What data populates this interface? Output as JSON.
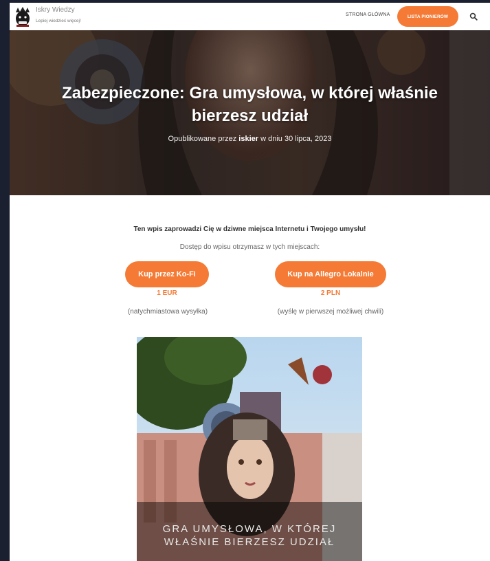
{
  "site": {
    "title": "Iskry Wiedzy",
    "tagline": "Lepiej wiedzieć więcej!"
  },
  "nav": {
    "home": "STRONA GŁÓWNA",
    "cta": "LISTA PIONIERÓW",
    "search_icon": "search-icon"
  },
  "post": {
    "title": "Zabezpieczone: Gra umysłowa, w której właśnie bierzesz udział",
    "meta_prefix": "Opublikowane przez",
    "author": "iskier",
    "meta_date": "w dniu 30 lipca, 2023"
  },
  "content": {
    "intro": "Ten wpis zaprowadzi Cię w dziwne miejsca Internetu i Twojego umysłu!",
    "access": "Dostęp do wpisu otrzymasz w tych miejscach:",
    "options": [
      {
        "button": "Kup przez Ko-Fi",
        "price": "1 EUR",
        "note": "(natychmiastowa wysyłka)"
      },
      {
        "button": "Kup na Allegro Lokalnie",
        "price": "2 PLN",
        "note": "(wyślę w pierwszej możliwej chwili)"
      }
    ],
    "image_caption_line1": "GRA UMYSŁOWA, W KTÓREJ",
    "image_caption_line2": "WŁAŚNIE BIERZESZ UDZIAŁ"
  },
  "colors": {
    "accent": "#f47a35",
    "page_bg": "#1b2030"
  }
}
